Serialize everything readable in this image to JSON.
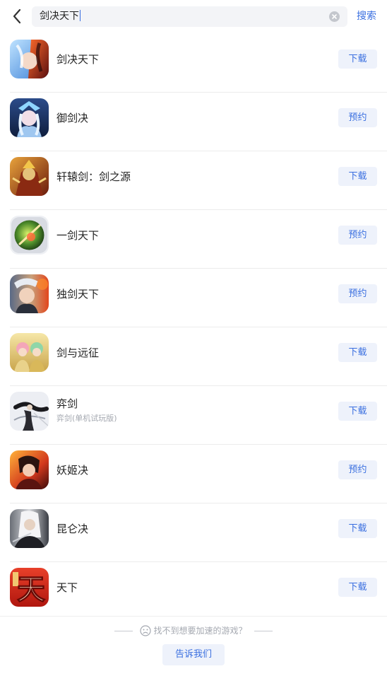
{
  "header": {
    "back_icon": "chevron-left-icon",
    "search_value": "剑决天下",
    "clear_icon": "clear-circle-icon",
    "search_button": "搜索"
  },
  "accent_color": "#3a6fe0",
  "results": [
    {
      "name": "剑决天下",
      "sub": "",
      "action": "下载",
      "icon": "game-icon-jianjuetianxia"
    },
    {
      "name": "御剑决",
      "sub": "",
      "action": "预约",
      "icon": "game-icon-yujianjue"
    },
    {
      "name": "轩辕剑：剑之源",
      "sub": "",
      "action": "下载",
      "icon": "game-icon-xuanyuanjian"
    },
    {
      "name": "一剑天下",
      "sub": "",
      "action": "预约",
      "icon": "game-icon-yijiantianxia"
    },
    {
      "name": "独剑天下",
      "sub": "",
      "action": "预约",
      "icon": "game-icon-dujiantianxia"
    },
    {
      "name": "剑与远征",
      "sub": "",
      "action": "下载",
      "icon": "game-icon-jianyuyuanzheng"
    },
    {
      "name": "弈剑",
      "sub": "弈剑(单机试玩版)",
      "action": "下载",
      "icon": "game-icon-yijian"
    },
    {
      "name": "妖姬决",
      "sub": "",
      "action": "预约",
      "icon": "game-icon-yaojijue"
    },
    {
      "name": "昆仑决",
      "sub": "",
      "action": "下载",
      "icon": "game-icon-kunlunjue"
    },
    {
      "name": "天下",
      "sub": "",
      "action": "下载",
      "icon": "game-icon-tianxia"
    }
  ],
  "footer": {
    "hint": "找不到想要加速的游戏？",
    "hint_icon": "sad-face-icon",
    "tell_button": "告诉我们",
    "tianxia_glyph": "天"
  }
}
